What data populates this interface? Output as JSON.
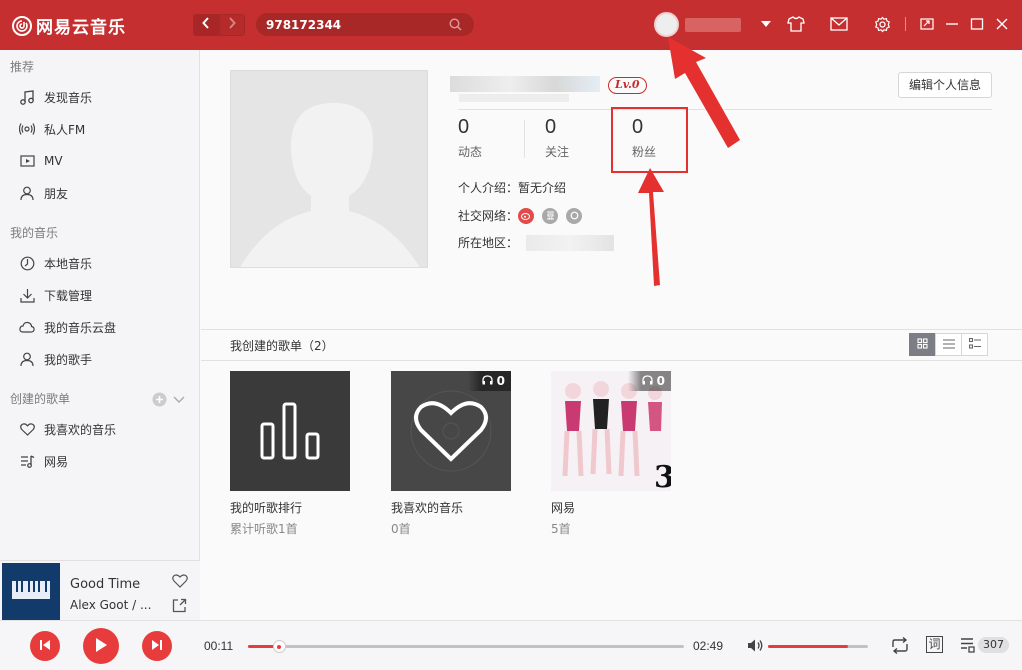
{
  "header": {
    "logo_text": "网易云音乐",
    "search_value": "978172344"
  },
  "sidebar": {
    "section_recommend": "推荐",
    "recommend_items": [
      {
        "label": "发现音乐",
        "icon": "music-note-icon"
      },
      {
        "label": "私人FM",
        "icon": "radio-icon"
      },
      {
        "label": "MV",
        "icon": "video-icon"
      },
      {
        "label": "朋友",
        "icon": "friends-icon"
      }
    ],
    "section_my_music": "我的音乐",
    "my_music_items": [
      {
        "label": "本地音乐",
        "icon": "local-music-icon"
      },
      {
        "label": "下载管理",
        "icon": "download-icon"
      },
      {
        "label": "我的音乐云盘",
        "icon": "cloud-icon"
      },
      {
        "label": "我的歌手",
        "icon": "singer-icon"
      }
    ],
    "section_created": "创建的歌单",
    "created_items": [
      {
        "label": "我喜欢的音乐",
        "icon": "heart-icon"
      },
      {
        "label": "网易",
        "icon": "playlist-icon"
      }
    ]
  },
  "now_playing": {
    "title": "Good Time",
    "artist": "Alex Goot / ..."
  },
  "profile": {
    "level": "Lv.0",
    "edit_button": "编辑个人信息",
    "stats": [
      {
        "num": "0",
        "label": "动态"
      },
      {
        "num": "0",
        "label": "关注"
      },
      {
        "num": "0",
        "label": "粉丝"
      }
    ],
    "intro_key": "个人介绍：",
    "intro_value": "暂无介绍",
    "social_key": "社交网络：",
    "region_key": "所在地区："
  },
  "playlists": {
    "header": "我创建的歌单（2）",
    "cards": [
      {
        "name": "我的听歌排行",
        "sub": "累计听歌1首",
        "play_count": ""
      },
      {
        "name": "我喜欢的音乐",
        "sub": "0首",
        "play_count": "0"
      },
      {
        "name": "网易",
        "sub": "5首",
        "play_count": "0"
      }
    ]
  },
  "player": {
    "current_time": "00:11",
    "total_time": "02:49",
    "progress": 0.07,
    "volume": 0.8,
    "lyrics_label": "词",
    "playlist_count": "307"
  },
  "colors": {
    "brand_red": "#c62f2f",
    "play_red": "#e83c3c",
    "annotation_red": "#e53030"
  }
}
